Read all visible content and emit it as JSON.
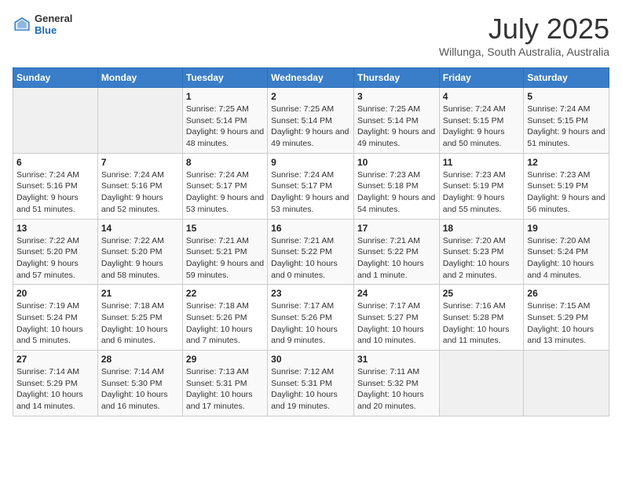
{
  "header": {
    "logo_general": "General",
    "logo_blue": "Blue",
    "month_title": "July 2025",
    "subtitle": "Willunga, South Australia, Australia"
  },
  "weekdays": [
    "Sunday",
    "Monday",
    "Tuesday",
    "Wednesday",
    "Thursday",
    "Friday",
    "Saturday"
  ],
  "weeks": [
    [
      {
        "day": "",
        "detail": ""
      },
      {
        "day": "",
        "detail": ""
      },
      {
        "day": "1",
        "detail": "Sunrise: 7:25 AM\nSunset: 5:14 PM\nDaylight: 9 hours and 48 minutes."
      },
      {
        "day": "2",
        "detail": "Sunrise: 7:25 AM\nSunset: 5:14 PM\nDaylight: 9 hours and 49 minutes."
      },
      {
        "day": "3",
        "detail": "Sunrise: 7:25 AM\nSunset: 5:14 PM\nDaylight: 9 hours and 49 minutes."
      },
      {
        "day": "4",
        "detail": "Sunrise: 7:24 AM\nSunset: 5:15 PM\nDaylight: 9 hours and 50 minutes."
      },
      {
        "day": "5",
        "detail": "Sunrise: 7:24 AM\nSunset: 5:15 PM\nDaylight: 9 hours and 51 minutes."
      }
    ],
    [
      {
        "day": "6",
        "detail": "Sunrise: 7:24 AM\nSunset: 5:16 PM\nDaylight: 9 hours and 51 minutes."
      },
      {
        "day": "7",
        "detail": "Sunrise: 7:24 AM\nSunset: 5:16 PM\nDaylight: 9 hours and 52 minutes."
      },
      {
        "day": "8",
        "detail": "Sunrise: 7:24 AM\nSunset: 5:17 PM\nDaylight: 9 hours and 53 minutes."
      },
      {
        "day": "9",
        "detail": "Sunrise: 7:24 AM\nSunset: 5:17 PM\nDaylight: 9 hours and 53 minutes."
      },
      {
        "day": "10",
        "detail": "Sunrise: 7:23 AM\nSunset: 5:18 PM\nDaylight: 9 hours and 54 minutes."
      },
      {
        "day": "11",
        "detail": "Sunrise: 7:23 AM\nSunset: 5:19 PM\nDaylight: 9 hours and 55 minutes."
      },
      {
        "day": "12",
        "detail": "Sunrise: 7:23 AM\nSunset: 5:19 PM\nDaylight: 9 hours and 56 minutes."
      }
    ],
    [
      {
        "day": "13",
        "detail": "Sunrise: 7:22 AM\nSunset: 5:20 PM\nDaylight: 9 hours and 57 minutes."
      },
      {
        "day": "14",
        "detail": "Sunrise: 7:22 AM\nSunset: 5:20 PM\nDaylight: 9 hours and 58 minutes."
      },
      {
        "day": "15",
        "detail": "Sunrise: 7:21 AM\nSunset: 5:21 PM\nDaylight: 9 hours and 59 minutes."
      },
      {
        "day": "16",
        "detail": "Sunrise: 7:21 AM\nSunset: 5:22 PM\nDaylight: 10 hours and 0 minutes."
      },
      {
        "day": "17",
        "detail": "Sunrise: 7:21 AM\nSunset: 5:22 PM\nDaylight: 10 hours and 1 minute."
      },
      {
        "day": "18",
        "detail": "Sunrise: 7:20 AM\nSunset: 5:23 PM\nDaylight: 10 hours and 2 minutes."
      },
      {
        "day": "19",
        "detail": "Sunrise: 7:20 AM\nSunset: 5:24 PM\nDaylight: 10 hours and 4 minutes."
      }
    ],
    [
      {
        "day": "20",
        "detail": "Sunrise: 7:19 AM\nSunset: 5:24 PM\nDaylight: 10 hours and 5 minutes."
      },
      {
        "day": "21",
        "detail": "Sunrise: 7:18 AM\nSunset: 5:25 PM\nDaylight: 10 hours and 6 minutes."
      },
      {
        "day": "22",
        "detail": "Sunrise: 7:18 AM\nSunset: 5:26 PM\nDaylight: 10 hours and 7 minutes."
      },
      {
        "day": "23",
        "detail": "Sunrise: 7:17 AM\nSunset: 5:26 PM\nDaylight: 10 hours and 9 minutes."
      },
      {
        "day": "24",
        "detail": "Sunrise: 7:17 AM\nSunset: 5:27 PM\nDaylight: 10 hours and 10 minutes."
      },
      {
        "day": "25",
        "detail": "Sunrise: 7:16 AM\nSunset: 5:28 PM\nDaylight: 10 hours and 11 minutes."
      },
      {
        "day": "26",
        "detail": "Sunrise: 7:15 AM\nSunset: 5:29 PM\nDaylight: 10 hours and 13 minutes."
      }
    ],
    [
      {
        "day": "27",
        "detail": "Sunrise: 7:14 AM\nSunset: 5:29 PM\nDaylight: 10 hours and 14 minutes."
      },
      {
        "day": "28",
        "detail": "Sunrise: 7:14 AM\nSunset: 5:30 PM\nDaylight: 10 hours and 16 minutes."
      },
      {
        "day": "29",
        "detail": "Sunrise: 7:13 AM\nSunset: 5:31 PM\nDaylight: 10 hours and 17 minutes."
      },
      {
        "day": "30",
        "detail": "Sunrise: 7:12 AM\nSunset: 5:31 PM\nDaylight: 10 hours and 19 minutes."
      },
      {
        "day": "31",
        "detail": "Sunrise: 7:11 AM\nSunset: 5:32 PM\nDaylight: 10 hours and 20 minutes."
      },
      {
        "day": "",
        "detail": ""
      },
      {
        "day": "",
        "detail": ""
      }
    ]
  ]
}
